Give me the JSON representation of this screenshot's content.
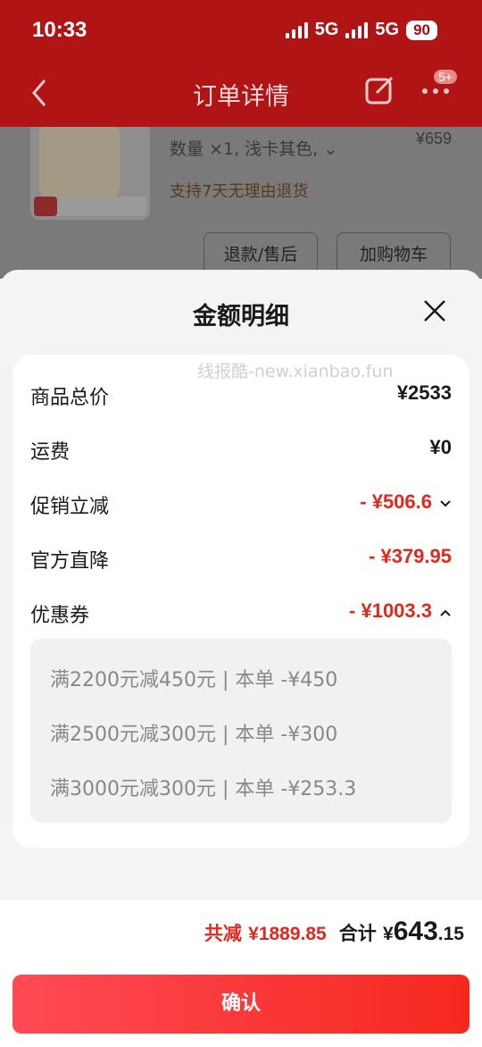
{
  "status_bar": {
    "time": "10:33",
    "network1": "5G",
    "network2": "5G",
    "battery": "90"
  },
  "nav": {
    "title": "订单详情",
    "badge": "5+"
  },
  "background": {
    "spec": "数量 ×1, 浅卡其色,",
    "price": "¥659",
    "refund_note": "支持7天无理由退货",
    "refund_button": "退款/售后",
    "cart_button": "加购物车"
  },
  "sheet": {
    "title": "金额明细",
    "watermark": "线报酷-new.xianbao.fun",
    "rows": [
      {
        "label": "商品总价",
        "value": "¥2533"
      },
      {
        "label": "运费",
        "value": "¥0"
      },
      {
        "label": "促销立减",
        "value": "- ¥506.6"
      },
      {
        "label": "官方直降",
        "value": "- ¥379.95"
      },
      {
        "label": "优惠券",
        "value": "- ¥1003.3"
      }
    ],
    "coupons": [
      "满2200元减450元 | 本单 -¥450",
      "满2500元减300元 | 本单 -¥300",
      "满3000元减300元 | 本单 -¥253.3"
    ]
  },
  "footer": {
    "reduce_label": "共减",
    "reduce_value": "¥1889.85",
    "total_label": "合计",
    "total_currency": "¥",
    "total_int": "643",
    "total_dec": ".15",
    "confirm": "确认"
  },
  "colors": {
    "accent": "#e0281e",
    "header": "#b01414"
  }
}
